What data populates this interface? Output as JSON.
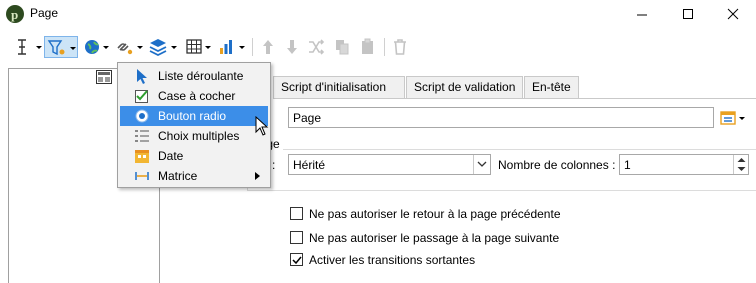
{
  "window": {
    "title": "Page"
  },
  "toolbar": {
    "buttons": [
      "text-cursor-icon",
      "filter-icon",
      "globe-icon",
      "link-icon",
      "layers-icon",
      "table-icon",
      "bar-chart-icon",
      "arrow-up-icon",
      "arrow-down-icon",
      "shuffle-icon",
      "copy-icon",
      "clipboard-icon",
      "delete-icon"
    ]
  },
  "tabs": [
    {
      "label": "Script d'initialisation"
    },
    {
      "label": "Script de validation"
    },
    {
      "label": "En-tête"
    }
  ],
  "form": {
    "label_value": "Page",
    "display_group_title": "hage",
    "inherited_label": "es :",
    "inherited_value": "Hérité",
    "columns_label": "Nombre de colonnes :",
    "columns_value": "1"
  },
  "options": [
    {
      "label": "Ne pas autoriser le retour à la page précédente",
      "checked": false
    },
    {
      "label": "Ne pas autoriser le passage à la page suivante",
      "checked": false
    },
    {
      "label": "Activer les transitions sortantes",
      "checked": true
    }
  ],
  "context_menu": {
    "items": [
      {
        "label": "Liste déroulante",
        "icon": "pointer-icon"
      },
      {
        "label": "Case à cocher",
        "icon": "checkbox-icon"
      },
      {
        "label": "Bouton radio",
        "icon": "radio-icon",
        "selected": true
      },
      {
        "label": "Choix multiples",
        "icon": "list-icon"
      },
      {
        "label": "Date",
        "icon": "calendar-icon"
      },
      {
        "label": "Matrice",
        "icon": "matrix-icon",
        "submenu": true
      }
    ]
  },
  "colors": {
    "selection": "#3c8ee8",
    "accent_blue": "#1e6fc8",
    "orange": "#e8a020"
  }
}
